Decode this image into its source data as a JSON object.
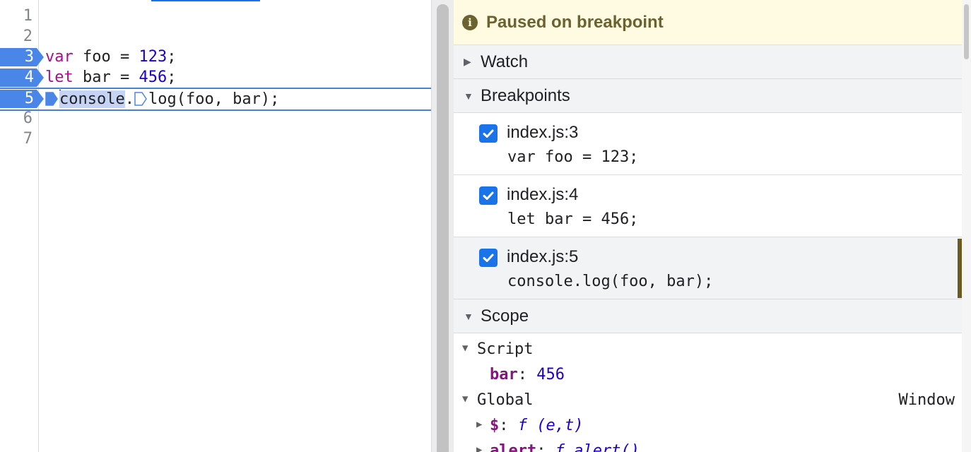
{
  "editor": {
    "line_numbers": [
      "1",
      "2",
      "3",
      "4",
      "5",
      "6",
      "7"
    ],
    "lines": {
      "l3": {
        "kw": "var",
        "rest": " foo = ",
        "num": "123",
        "end": ";"
      },
      "l4": {
        "kw": "let",
        "rest": " bar = ",
        "num": "456",
        "end": ";"
      },
      "l5": {
        "sel": "console",
        "dot": ".",
        "rest": "log(foo, bar);"
      }
    }
  },
  "debugger": {
    "status": "Paused on breakpoint",
    "sections": {
      "watch": "Watch",
      "breakpoints": "Breakpoints",
      "scope": "Scope"
    },
    "breakpoints": [
      {
        "location": "index.js:3",
        "code": "var foo = 123;",
        "checked": true
      },
      {
        "location": "index.js:4",
        "code": "let bar = 456;",
        "checked": true
      },
      {
        "location": "index.js:5",
        "code": "console.log(foo, bar);",
        "checked": true
      }
    ],
    "scope": {
      "script_label": "Script",
      "script_var_name": "bar",
      "script_var_sep": ": ",
      "script_var_value": "456",
      "global_label": "Global",
      "global_value": "Window",
      "global_items": [
        {
          "name": "$",
          "sep": ": ",
          "fn": "f",
          "sig": " (e,t)"
        },
        {
          "name": "alert",
          "sep": ": ",
          "fn": "f",
          "sig": " alert()"
        }
      ]
    }
  },
  "colors": {
    "accent": "#1a73e8",
    "breakpoint_marker": "#4a86e8",
    "paused_bg": "#fefbe2",
    "paused_text": "#6b6230"
  }
}
